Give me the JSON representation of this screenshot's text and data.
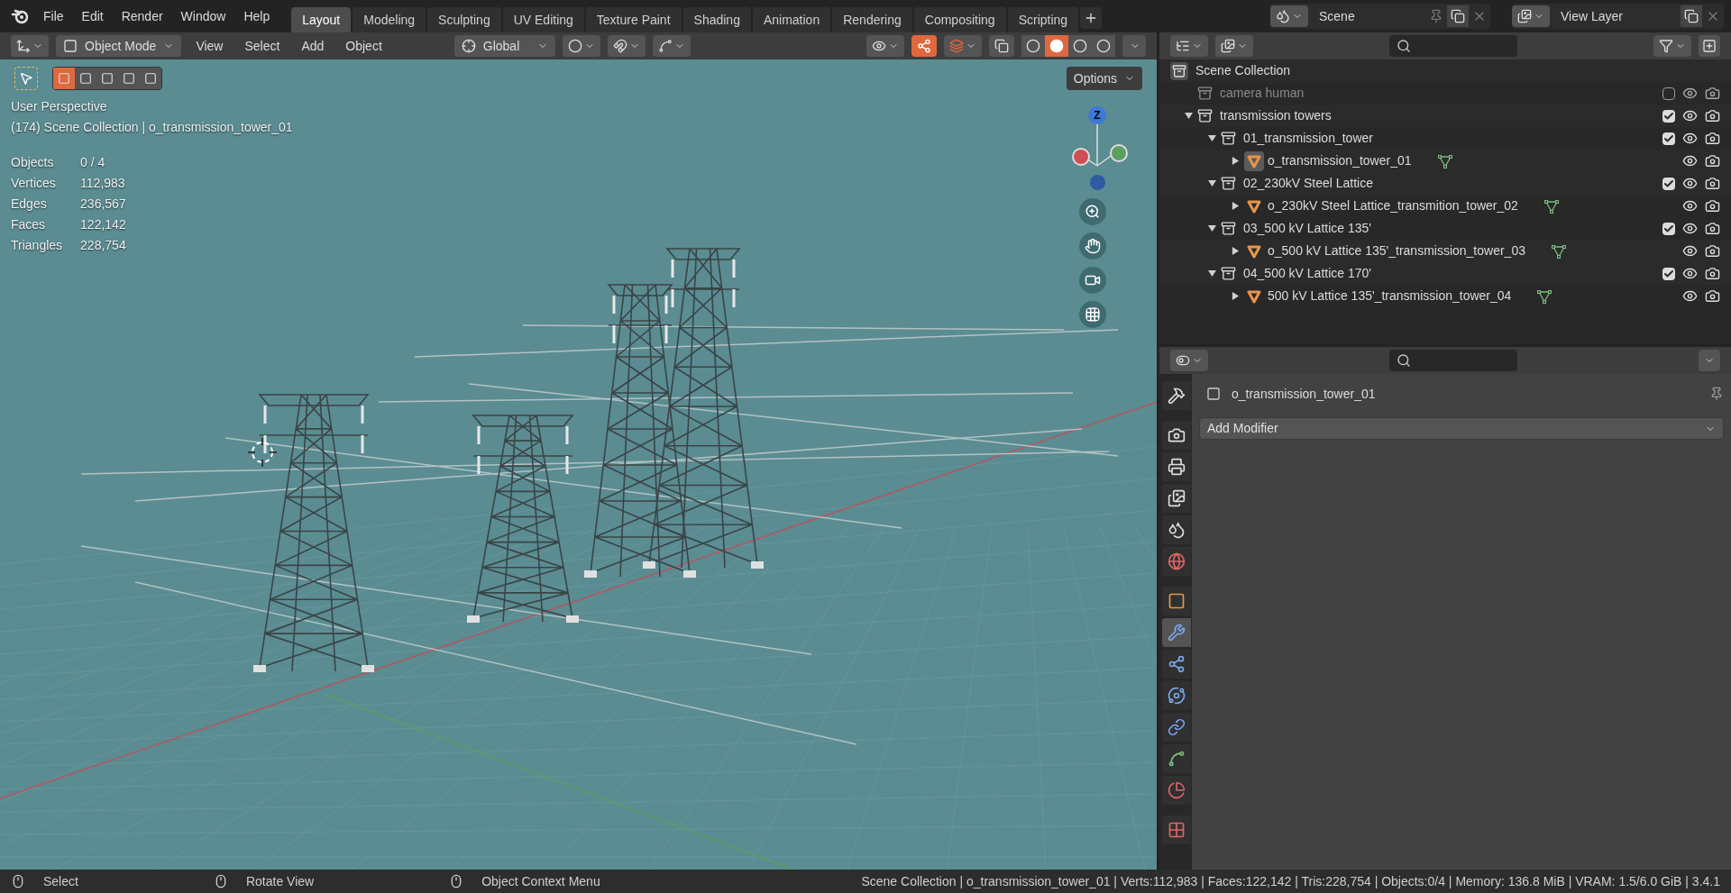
{
  "top_menu": [
    "File",
    "Edit",
    "Render",
    "Window",
    "Help"
  ],
  "workspace_tabs": [
    {
      "label": "Layout",
      "selected": true
    },
    {
      "label": "Modeling",
      "selected": false
    },
    {
      "label": "Sculpting",
      "selected": false
    },
    {
      "label": "UV Editing",
      "selected": false
    },
    {
      "label": "Texture Paint",
      "selected": false
    },
    {
      "label": "Shading",
      "selected": false
    },
    {
      "label": "Animation",
      "selected": false
    },
    {
      "label": "Rendering",
      "selected": false
    },
    {
      "label": "Compositing",
      "selected": false
    },
    {
      "label": "Scripting",
      "selected": false
    }
  ],
  "scene": {
    "name": "Scene"
  },
  "view_layer": {
    "name": "View Layer"
  },
  "viewport_header": {
    "mode": "Object Mode",
    "menus": [
      "View",
      "Select",
      "Add",
      "Object"
    ],
    "orientation": "Global",
    "shading": [
      {
        "selected": false
      },
      {
        "selected": true
      },
      {
        "selected": false
      },
      {
        "selected": false
      }
    ]
  },
  "viewport": {
    "select_modes": [
      {
        "selected": true
      },
      {
        "selected": false
      },
      {
        "selected": false
      },
      {
        "selected": false
      },
      {
        "selected": false
      }
    ],
    "options": "Options",
    "perspective": "User Perspective",
    "collection_line": "(174) Scene Collection | o_transmission_tower_01",
    "stats": [
      {
        "label": "Objects",
        "value": "0 / 4"
      },
      {
        "label": "Vertices",
        "value": "112,983"
      },
      {
        "label": "Edges",
        "value": "236,567"
      },
      {
        "label": "Faces",
        "value": "122,142"
      },
      {
        "label": "Triangles",
        "value": "228,754"
      }
    ],
    "gizmo_z": "Z"
  },
  "outliner": {
    "root": "Scene Collection",
    "items": [
      {
        "kind": "collection",
        "label": "camera human",
        "disabled": true,
        "checked": false
      },
      {
        "kind": "collection",
        "label": "transmission towers",
        "disabled": false,
        "checked": true,
        "expanded": true,
        "children": [
          {
            "kind": "collection",
            "label": "01_transmission_tower",
            "disabled": false,
            "checked": true,
            "expanded": true,
            "children": [
              {
                "kind": "object",
                "label": "o_transmission_tower_01",
                "active": true,
                "expanded": false
              }
            ]
          },
          {
            "kind": "collection",
            "label": "02_230kV Steel Lattice",
            "disabled": false,
            "checked": true,
            "expanded": true,
            "children": [
              {
                "kind": "object",
                "label": "o_230kV Steel Lattice_transmition_tower_02",
                "active": false,
                "expanded": false
              }
            ]
          },
          {
            "kind": "collection",
            "label": "03_500 kV Lattice 135'",
            "disabled": false,
            "checked": true,
            "expanded": true,
            "children": [
              {
                "kind": "object",
                "label": "o_500 kV Lattice 135'_transmission_tower_03",
                "active": false,
                "expanded": false
              }
            ]
          },
          {
            "kind": "collection",
            "label": "04_500 kV Lattice 170'",
            "disabled": false,
            "checked": true,
            "expanded": true,
            "children": [
              {
                "kind": "object",
                "label": "500 kV Lattice 135'_transmission_tower_04",
                "active": false,
                "expanded": false
              }
            ]
          }
        ]
      }
    ]
  },
  "properties": {
    "object_name": "o_transmission_tower_01",
    "add_modifier": "Add Modifier",
    "tabs": [
      {
        "kind": "tool",
        "selected": false
      },
      {
        "kind": "render",
        "selected": false
      },
      {
        "kind": "output",
        "selected": false
      },
      {
        "kind": "view_layer",
        "selected": false
      },
      {
        "kind": "scene",
        "selected": false
      },
      {
        "kind": "world",
        "selected": false
      },
      {
        "kind": "object",
        "selected": false
      },
      {
        "kind": "modifier",
        "selected": true
      },
      {
        "kind": "particles",
        "selected": false
      },
      {
        "kind": "physics",
        "selected": false
      },
      {
        "kind": "constraints",
        "selected": false
      },
      {
        "kind": "data",
        "selected": false
      },
      {
        "kind": "material",
        "selected": false
      },
      {
        "kind": "texture",
        "selected": false
      }
    ]
  },
  "status_bar": {
    "hints": [
      "Select",
      "Rotate View",
      "Object Context Menu"
    ],
    "info": "Scene Collection | o_transmission_tower_01 | Verts:112,983 | Faces:122,142 | Tris:228,754 | Objects:0/4 | Memory: 136.8 MiB | VRAM: 1.5/6.0 GiB | 3.4.1"
  }
}
